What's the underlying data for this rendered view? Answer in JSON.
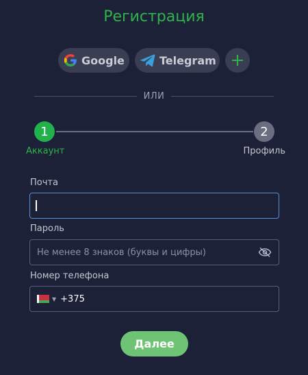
{
  "page": {
    "title": "Регистрация"
  },
  "social": {
    "google_label": "Google",
    "telegram_label": "Telegram",
    "more_icon": "plus-icon"
  },
  "divider": {
    "text": "ИЛИ"
  },
  "steps": [
    {
      "number": "1",
      "label": "Аккаунт",
      "state": "active"
    },
    {
      "number": "2",
      "label": "Профиль",
      "state": "pending"
    }
  ],
  "form": {
    "email": {
      "label": "Почта",
      "value": "",
      "placeholder": ""
    },
    "password": {
      "label": "Пароль",
      "value": "",
      "placeholder": "Не менее 8 знаков (буквы и цифры)",
      "icon": "eye-off-icon"
    },
    "phone": {
      "label": "Номер телефона",
      "country": "BY",
      "code": "+375"
    }
  },
  "submit_label": "Далее",
  "colors": {
    "background": "#1c2138",
    "accent": "#2fb44a",
    "button": "#6fc374",
    "focus": "#5b8fd6"
  }
}
